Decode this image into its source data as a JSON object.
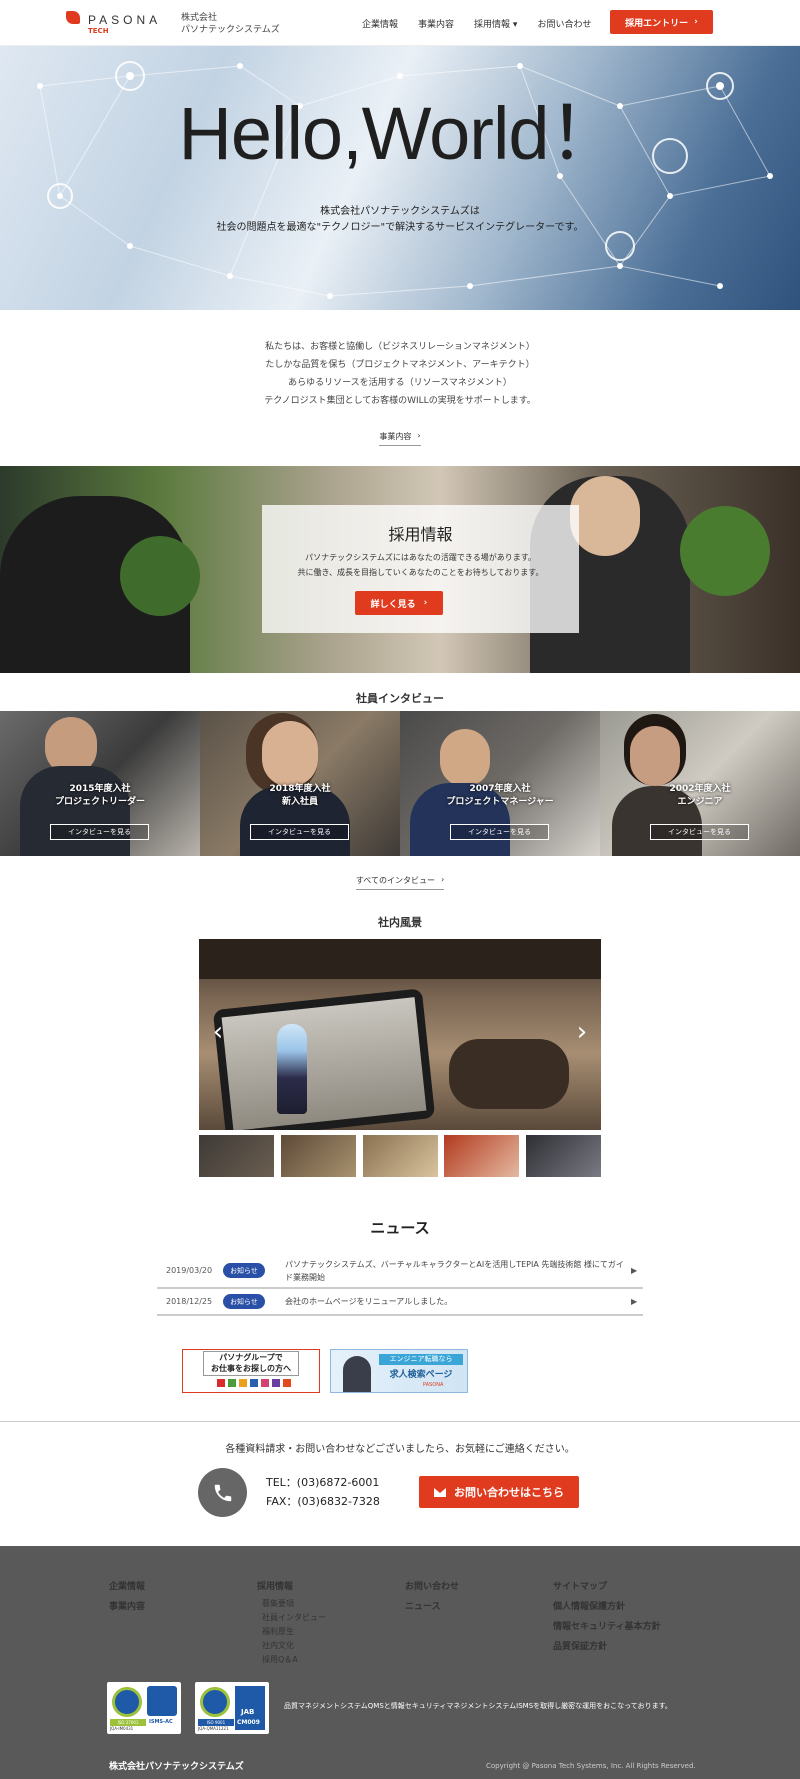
{
  "header": {
    "logo_text": "PASONA",
    "logo_sub": "TECH",
    "company_line1": "株式会社",
    "company_line2": "パソナテックシステムズ",
    "nav": [
      {
        "label": "企業情報"
      },
      {
        "label": "事業内容"
      },
      {
        "label": "採用情報"
      },
      {
        "label": "お問い合わせ"
      }
    ],
    "entry_label": "採用エントリー"
  },
  "hero": {
    "title": "Hello,World！",
    "sub_line1": "株式会社パソナテックシステムズは",
    "sub_line2": "社会の問題点を最適な\"テクノロジー\"で解決するサービスインテグレーターです。"
  },
  "intro": {
    "lines": [
      "私たちは、お客様と協働し（ビジネスリレーションマネジメント）",
      "たしかな品質を保ち（プロジェクトマネジメント、アーキテクト）",
      "あらゆるリソースを活用する（リソースマネジメント）",
      "テクノロジスト集団としてお客様のWILLの実現をサポートします。"
    ],
    "link": "事業内容"
  },
  "recruit": {
    "title": "採用情報",
    "line1": "パソナテックシステムズにはあなたの活躍できる場があります。",
    "line2": "共に働き、成長を目指していくあなたのことをお待ちしております。",
    "button": "詳しく見る"
  },
  "interviews": {
    "title": "社員インタビュー",
    "items": [
      {
        "line1": "2015年度入社",
        "line2": "プロジェクトリーダー",
        "button": "インタビューを見る"
      },
      {
        "line1": "2018年度入社",
        "line2": "新入社員",
        "button": "インタビューを見る"
      },
      {
        "line1": "2007年度入社",
        "line2": "プロジェクトマネージャー",
        "button": "インタビューを見る"
      },
      {
        "line1": "2002年度入社",
        "line2": "エンジニア",
        "button": "インタビューを見る"
      }
    ],
    "all_link": "すべてのインタビュー"
  },
  "scenery": {
    "title": "社内風景",
    "prev_icon": "chevron-left-icon",
    "next_icon": "chevron-right-icon"
  },
  "news": {
    "title": "ニュース",
    "items": [
      {
        "date": "2019/03/20",
        "badge": "お知らせ",
        "text": "パソナテックシステムズ、バーチャルキャラクターとAIを活用しTEPIA 先端技術館 様にてガイド業務開始"
      },
      {
        "date": "2018/12/25",
        "badge": "お知らせ",
        "text": "会社のホームページをリニューアルしました。"
      }
    ]
  },
  "banners": {
    "left_line1": "パソナグループで",
    "left_line2": "お仕事をお探しの方へ",
    "right_line1": "エンジニア転職なら",
    "right_line2": "求人検索ページ",
    "right_logo": "PASONA"
  },
  "contact": {
    "message": "各種資料請求・お問い合わせなどございましたら、お気軽にご連絡ください。",
    "tel": "TEL：(03)6872-6001",
    "fax": "FAX：(03)6832-7328",
    "button": "お問い合わせはこちら"
  },
  "footer": {
    "col1": [
      "企業情報",
      "事業内容"
    ],
    "col2_title": "採用情報",
    "col2_items": [
      "募集要項",
      "社員インタビュー",
      "福利厚生",
      "社内文化",
      "採用Q＆A"
    ],
    "col3": [
      "お問い合わせ",
      "ニュース"
    ],
    "col4": [
      "サイトマップ",
      "個人情報保護方針",
      "情報セキュリティ基本方針",
      "品質保証方針"
    ],
    "cert_text": "品質マネジメントシステムQMSと情報セキュリティマネジメントシステムISMSを取得し厳密な運用をおこなっております。",
    "cert1_a": "ISO 27001",
    "cert1_b": "JQA-IM0431",
    "cert1_c": "ISMS-AC",
    "cert2_a": "ISO 9001",
    "cert2_b": "JQA-QMA11221",
    "cert2_c": "JAB",
    "cert2_d": "CM009",
    "company": "株式会社パソナテックシステムズ",
    "copyright": "Copyright @ Pasona Tech Systems, Inc. All Rights Reserved."
  },
  "colors": {
    "accent": "#e03b1f",
    "badge": "#2a4fa6",
    "footer": "#595959"
  }
}
